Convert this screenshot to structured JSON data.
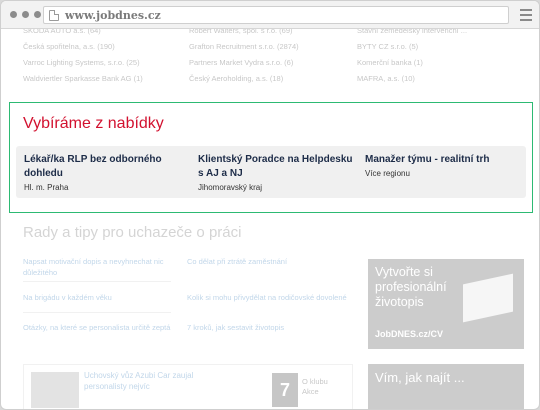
{
  "browser": {
    "url": "www.jobdnes.cz"
  },
  "companies": {
    "col1": [
      "SKODA AUTO a.s. (64)",
      "Česká spořitelna, a.s. (190)",
      "Varroc Lighting Systems, s.r.o. (25)",
      "Waldviertler Sparkasse Bank AG (1)"
    ],
    "col2": [
      "Robert Walters, spol. s r.o. (69)",
      "Grafton Recruitment s.r.o. (2874)",
      "Partners Market Vydra s.r.o. (6)",
      "Český Aeroholding, a.s. (18)"
    ],
    "col3": [
      "Stavní zemědělský intervenční ...",
      "BYTY CZ s.r.o. (5)",
      "Komerční banka (1)",
      "MAFRA, a.s. (10)"
    ]
  },
  "featured": {
    "title": "Vybíráme z nabídky",
    "jobs": [
      {
        "title": "Lékař/ka RLP bez odborného dohledu",
        "location": "Hl. m. Praha"
      },
      {
        "title": "Klientský Poradce na Helpdesku s AJ a NJ",
        "location": "Jihomoravský kraj"
      },
      {
        "title": "Manažer týmu - realitní trh",
        "location": "Více regionu"
      }
    ]
  },
  "tips": {
    "title": "Rady a tipy pro uchazeče o práci",
    "left": [
      "Napsat motivační dopis a nevyhnechat nic důležitého",
      "Na brigádu v každém věku",
      "Otázky, na které se personalista určitě zeptá"
    ],
    "right": [
      "Co dělat při ztrátě zaměstnání",
      "Kolik si mohu přivydělat na rodičovské dovolené",
      "7 kroků, jak sestavit životopis"
    ]
  },
  "promo": {
    "text": "Vytvořte si profesionální životopis",
    "sub": "JobDNES.cz/CV"
  },
  "promo2": {
    "text": "Vím, jak najít ..."
  },
  "news": {
    "text": "Uchovský vůz Azubi Car zaujal personalisty nejvíc",
    "badge": "7",
    "badge_text": "O klubu Akce"
  }
}
